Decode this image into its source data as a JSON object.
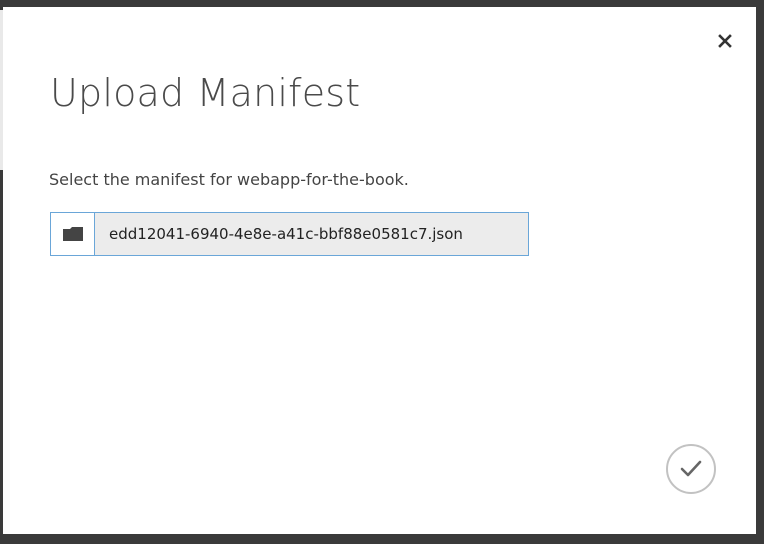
{
  "dialog": {
    "title": "Upload Manifest",
    "prompt": "Select the manifest for webapp-for-the-book.",
    "file_name": "edd12041-6940-4e8e-a41c-bbf88e0581c7.json"
  },
  "icons": {
    "close": "close-icon",
    "browse": "folder-icon",
    "confirm": "checkmark-icon"
  },
  "colors": {
    "overlay": "#3a3a3a",
    "dialog_bg": "#ffffff",
    "input_border": "#6aa6d8",
    "input_bg": "#ececec",
    "title_text": "#4a4a4a"
  }
}
